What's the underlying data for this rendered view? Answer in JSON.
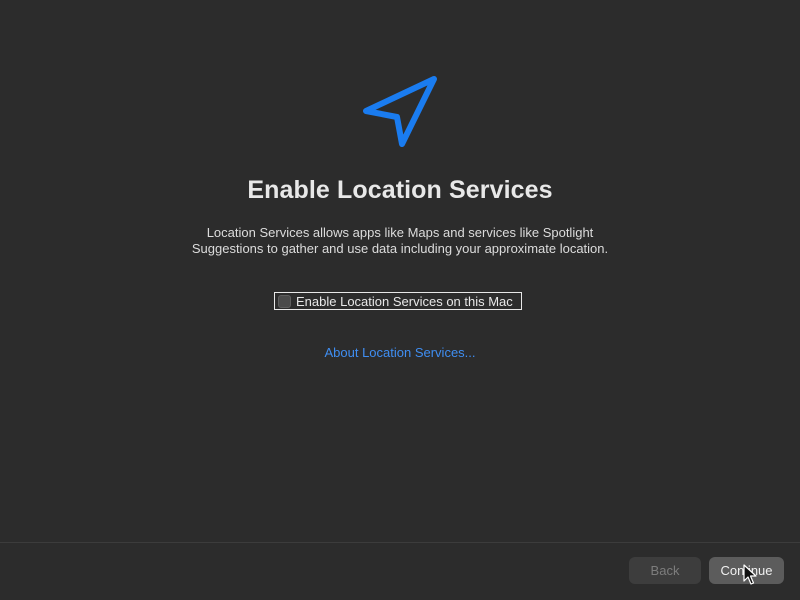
{
  "screen": {
    "title": "Enable Location Services",
    "description_line1": "Location Services allows apps like Maps and services like Spotlight",
    "description_line2": "Suggestions to gather and use data including your approximate location.",
    "checkbox": {
      "label": "Enable Location Services on this Mac",
      "checked": false
    },
    "about_link": "About Location Services..."
  },
  "footer": {
    "back_label": "Back",
    "continue_label": "Continue"
  },
  "icons": {
    "hero": "location-arrow-icon",
    "pointer": "mouse-cursor-icon"
  },
  "colors": {
    "background": "#2c2c2c",
    "accent": "#1a7cf0",
    "link": "#3f8ef2"
  }
}
